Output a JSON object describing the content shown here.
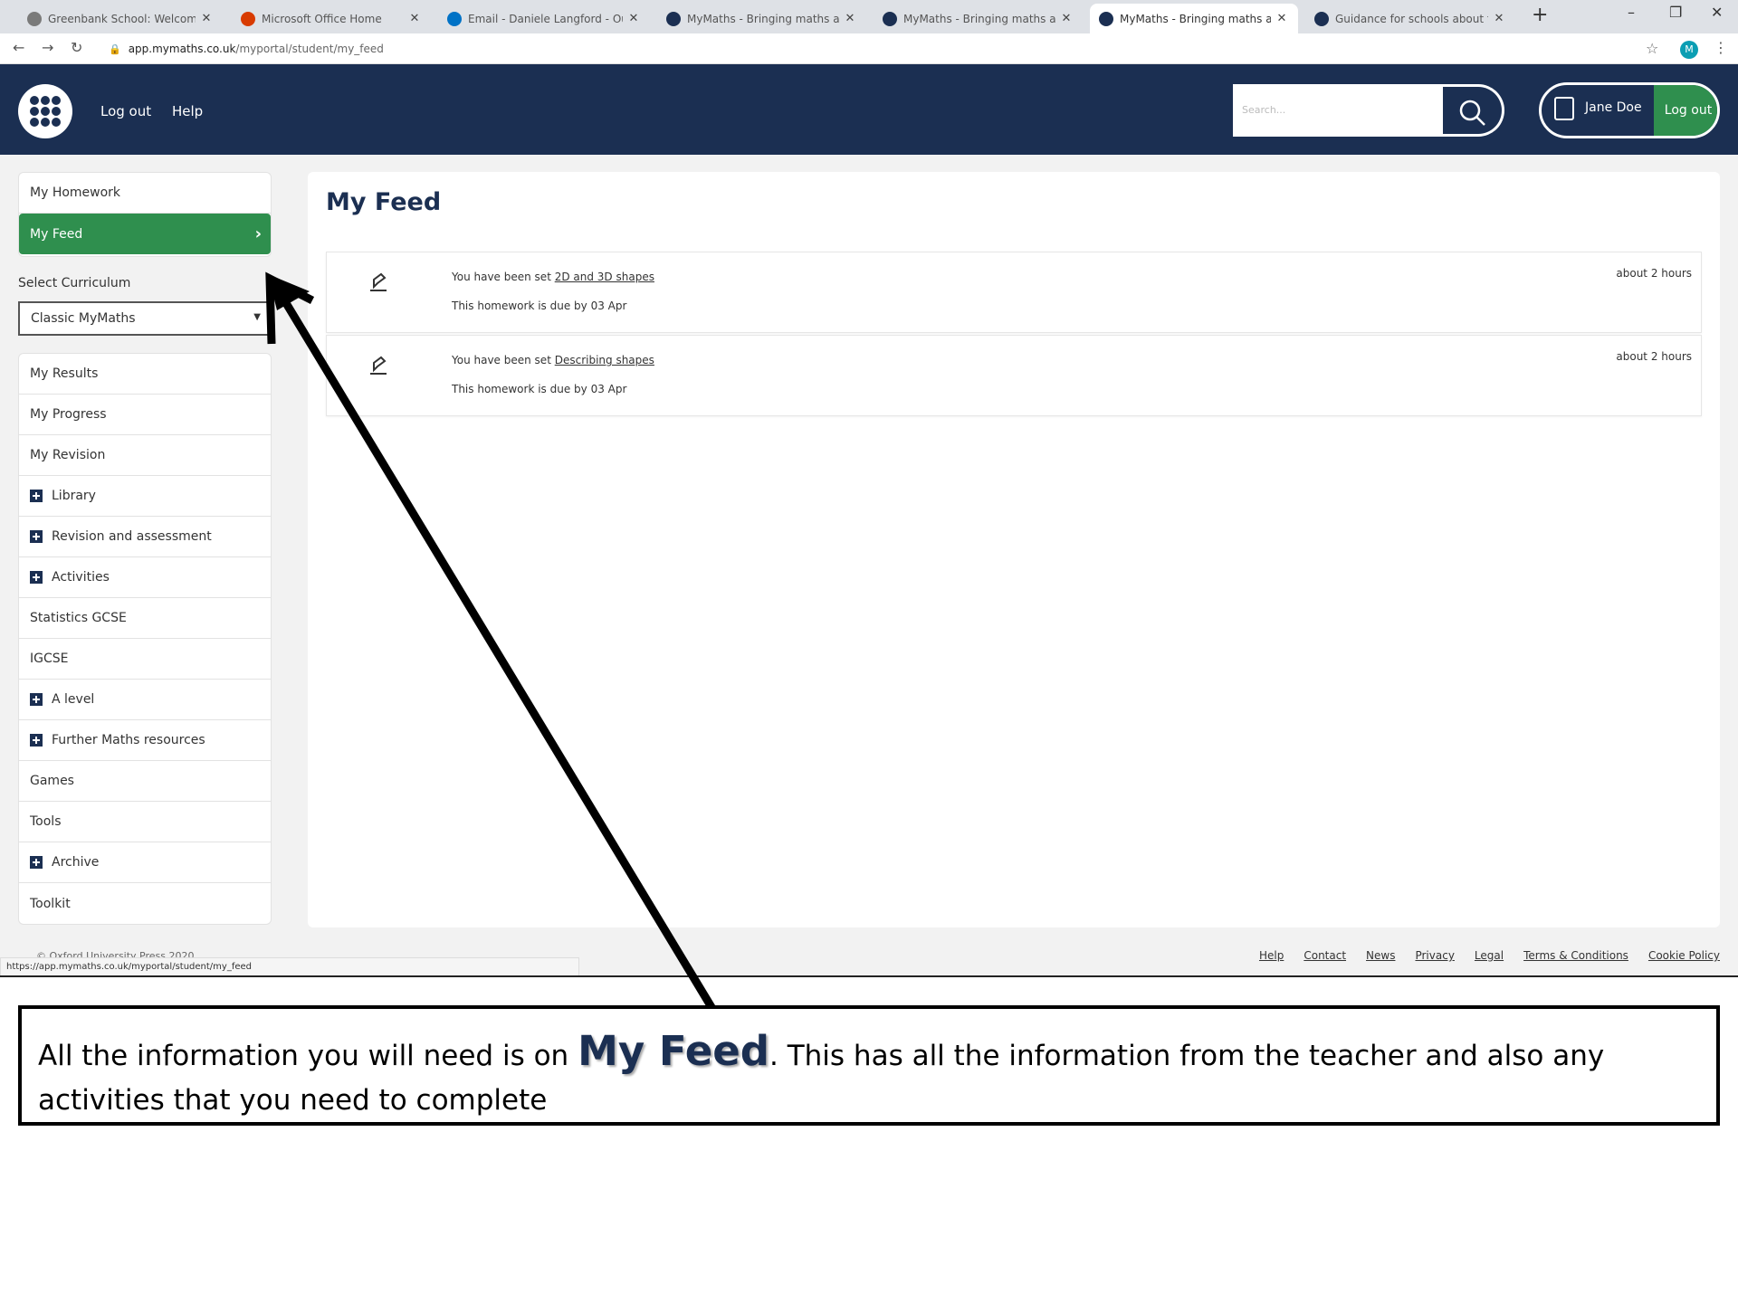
{
  "browser": {
    "tabs": [
      {
        "label": "Greenbank School: Welcome to",
        "icon": "school-favicon-icon",
        "color": "#7a7a7a"
      },
      {
        "label": "Microsoft Office Home",
        "icon": "office-favicon-icon",
        "color": "#d83b01"
      },
      {
        "label": "Email - Daniele Langford - Outl",
        "icon": "outlook-favicon-icon",
        "color": "#0072c6"
      },
      {
        "label": "MyMaths - Bringing maths alive",
        "icon": "mymaths-favicon-icon",
        "color": "#1b2f52"
      },
      {
        "label": "MyMaths - Bringing maths alive",
        "icon": "mymaths-favicon-icon",
        "color": "#1b2f52"
      },
      {
        "label": "MyMaths - Bringing maths alive",
        "icon": "mymaths-favicon-icon",
        "color": "#1b2f52"
      },
      {
        "label": "Guidance for schools about ter",
        "icon": "doc-favicon-icon",
        "color": "#1b2f52"
      }
    ],
    "url_host": "app.mymaths.co.uk",
    "url_path": "/myportal/student/my_feed",
    "profile_initial": "M",
    "status_url": "https://app.mymaths.co.uk/myportal/student/my_feed"
  },
  "header": {
    "logout_label": "Log out",
    "help_label": "Help",
    "search_placeholder": "Search...",
    "user_name": "Jane Doe",
    "user_logout_label": "Log out"
  },
  "sidebar": {
    "top_items": [
      {
        "label": "My Homework"
      },
      {
        "label": "My Feed",
        "active": true
      }
    ],
    "curriculum_label": "Select Curriculum",
    "curriculum_value": "Classic MyMaths",
    "items": [
      {
        "label": "My Results"
      },
      {
        "label": "My Progress"
      },
      {
        "label": "My Revision"
      },
      {
        "label": "Library",
        "expandable": true
      },
      {
        "label": "Revision and assessment",
        "expandable": true
      },
      {
        "label": "Activities",
        "expandable": true
      },
      {
        "label": "Statistics GCSE"
      },
      {
        "label": "IGCSE"
      },
      {
        "label": "A level",
        "expandable": true
      },
      {
        "label": "Further Maths resources",
        "expandable": true
      },
      {
        "label": "Games"
      },
      {
        "label": "Tools"
      },
      {
        "label": "Archive",
        "expandable": true
      },
      {
        "label": "Toolkit"
      }
    ]
  },
  "main": {
    "title": "My Feed",
    "feed": [
      {
        "prefix": "You have been set ",
        "link": "2D and 3D shapes",
        "due": "This homework is due by 03 Apr",
        "time": "about 2 hours"
      },
      {
        "prefix": "You have been set ",
        "link": "Describing shapes",
        "due": "This homework is due by 03 Apr",
        "time": "about 2 hours"
      }
    ]
  },
  "footer": {
    "copyright": "© Oxford University Press 2020",
    "links": [
      "Help",
      "Contact",
      "News",
      "Privacy",
      "Legal",
      "Terms & Conditions",
      "Cookie Policy"
    ]
  },
  "annotation": {
    "text_before": "All the information you will need is on ",
    "emphasis": "My Feed",
    "text_after": ".  This has all the information from the teacher and also any activities that you need to complete"
  },
  "colors": {
    "navy": "#1b2f52",
    "green": "#2f8f4e"
  }
}
